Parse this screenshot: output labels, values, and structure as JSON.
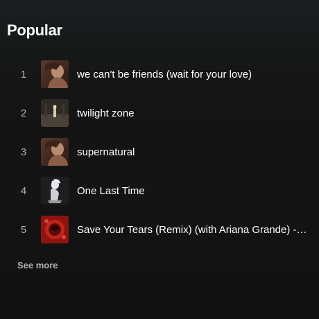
{
  "section": {
    "title": "Popular",
    "see_more_label": "See more"
  },
  "tracks": [
    {
      "index": "1",
      "title": "we can't be friends (wait for your love)",
      "art": "eternal-sunshine-cover"
    },
    {
      "index": "2",
      "title": "twilight zone",
      "art": "twilight-zone-cover"
    },
    {
      "index": "3",
      "title": "supernatural",
      "art": "eternal-sunshine-cover"
    },
    {
      "index": "4",
      "title": "One Last Time",
      "art": "my-everything-cover"
    },
    {
      "index": "5",
      "title": "Save Your Tears (Remix) (with Ariana Grande) - Single",
      "art": "save-your-tears-cover"
    }
  ],
  "colors": {
    "background": "#121212",
    "text_primary": "#ffffff",
    "text_secondary": "#b3b3b3"
  }
}
